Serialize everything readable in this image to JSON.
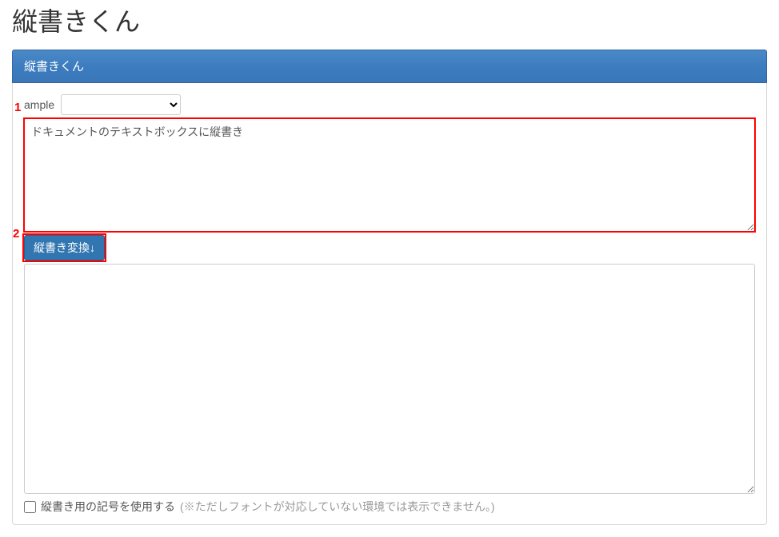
{
  "page": {
    "title": "縦書きくん"
  },
  "panel": {
    "title": "縦書きくん"
  },
  "sample": {
    "label": "ample",
    "selected": ""
  },
  "input": {
    "value": "ドキュメントのテキストボックスに縦書き"
  },
  "convert": {
    "label": "縦書き変換↓"
  },
  "output": {
    "value": ""
  },
  "checkbox": {
    "label": "縦書き用の記号を使用する",
    "hint": "(※ただしフォントが対応していない環境では表示できません。)"
  },
  "annotations": {
    "one": "1",
    "two": "2"
  }
}
